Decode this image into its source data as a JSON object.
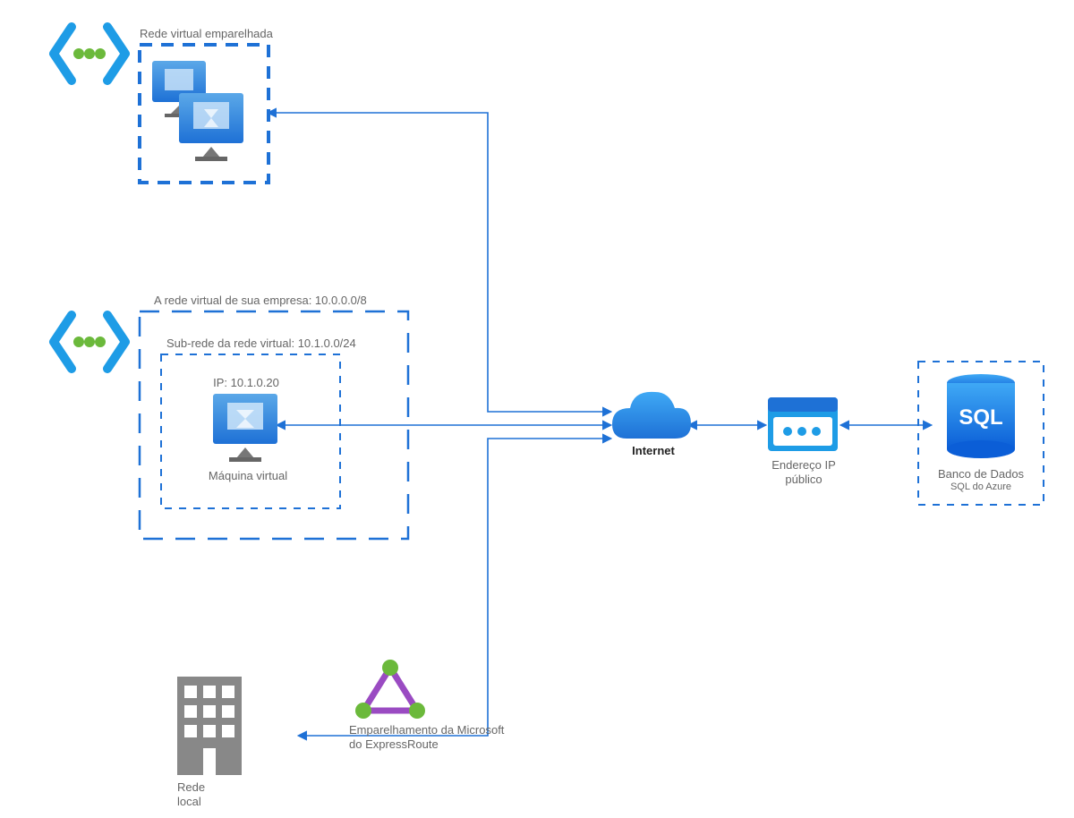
{
  "peered_vnet": {
    "title": "Rede virtual emparelhada"
  },
  "company_vnet": {
    "title": "A rede virtual de sua empresa: 10.0.0.0/8",
    "subnet": "Sub-rede da rede virtual: 10.1.0.0/24",
    "vm_ip": "IP: 10.1.0.20",
    "vm_label": "Máquina virtual"
  },
  "onprem": {
    "label_line1": "Rede",
    "label_line2": "local"
  },
  "expressroute": {
    "label_line1": "Emparelhamento da Microsoft",
    "label_line2": "do ExpressRoute"
  },
  "internet": {
    "label": "Internet"
  },
  "public_ip": {
    "label_line1": "Endereço IP",
    "label_line2": "público"
  },
  "sql": {
    "label_line1": "Banco de Dados",
    "label_line2": "SQL do Azure"
  }
}
